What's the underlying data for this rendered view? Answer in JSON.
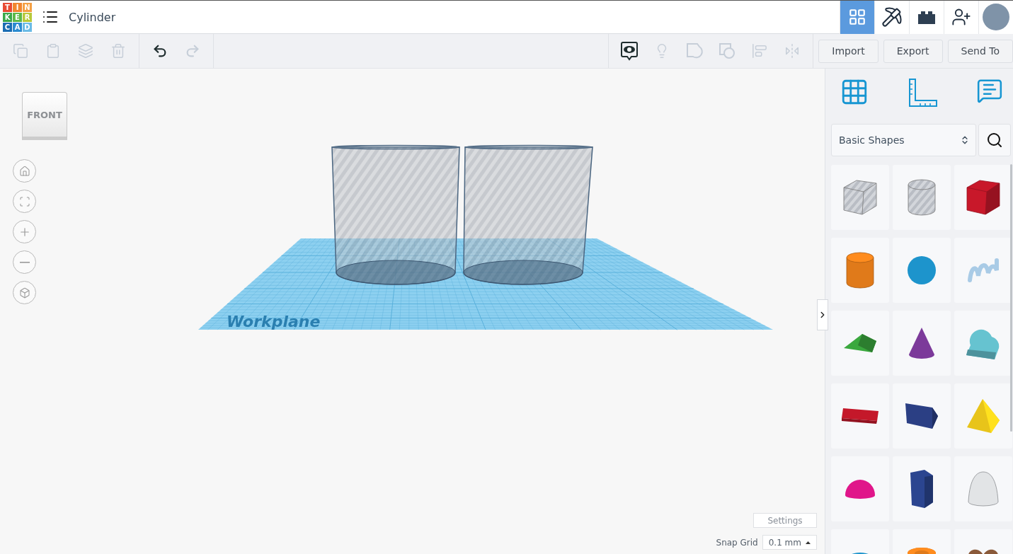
{
  "header": {
    "logo_letters": [
      {
        "text": "T",
        "color": "#e84b34"
      },
      {
        "text": "I",
        "color": "#f2862f"
      },
      {
        "text": "N",
        "color": "#f5a044"
      },
      {
        "text": "K",
        "color": "#3aa84a"
      },
      {
        "text": "E",
        "color": "#5cb947"
      },
      {
        "text": "R",
        "color": "#b7c93a"
      },
      {
        "text": "C",
        "color": "#1b6db3"
      },
      {
        "text": "A",
        "color": "#2b8bd0"
      },
      {
        "text": "D",
        "color": "#6bbbe6"
      }
    ],
    "design_title": "Cylinder",
    "nav_tabs": [
      {
        "kind": "grid",
        "selected": true
      },
      {
        "kind": "pickaxe",
        "selected": false
      },
      {
        "kind": "bricks",
        "selected": false
      },
      {
        "kind": "add-user",
        "selected": false
      },
      {
        "kind": "avatar",
        "selected": false
      }
    ]
  },
  "toolbar": {
    "edit_tools": [
      {
        "kind": "copy",
        "disabled": true
      },
      {
        "kind": "paste",
        "disabled": true
      },
      {
        "kind": "duplicate",
        "disabled": true
      },
      {
        "kind": "delete",
        "disabled": true
      }
    ],
    "history_tools": [
      {
        "kind": "undo",
        "disabled": false
      },
      {
        "kind": "redo",
        "disabled": true
      }
    ],
    "view_tools": [
      {
        "kind": "notes",
        "disabled": false
      },
      {
        "kind": "light",
        "disabled": true
      },
      {
        "kind": "group",
        "disabled": true
      },
      {
        "kind": "hole",
        "disabled": true
      },
      {
        "kind": "align",
        "disabled": true
      },
      {
        "kind": "mirror",
        "disabled": true
      }
    ],
    "actions": [
      "Import",
      "Export",
      "Send To"
    ]
  },
  "canvas": {
    "view_cube_face": "FRONT",
    "nav_controls": [
      {
        "kind": "home"
      },
      {
        "kind": "fit"
      },
      {
        "kind": "zoom-in"
      },
      {
        "kind": "zoom-out"
      },
      {
        "kind": "perspective"
      }
    ],
    "workplane_label": "Workplane",
    "scene_shapes": [
      {
        "kind": "hole-cylinder"
      },
      {
        "kind": "hole-cylinder"
      }
    ],
    "settings": "Settings",
    "snap_grid_label": "Snap Grid",
    "snap_grid_value": "0.1 mm"
  },
  "panel": {
    "tools": [
      {
        "kind": "workplane"
      },
      {
        "kind": "ruler"
      },
      {
        "kind": "notes"
      }
    ],
    "category": "Basic Shapes",
    "shapes": [
      {
        "kind": "box-hole",
        "color": "#c8cbd2"
      },
      {
        "kind": "cylinder-hole",
        "color": "#c8cbd2"
      },
      {
        "kind": "box",
        "color": "#c8182a"
      },
      {
        "kind": "cylinder",
        "color": "#e07a1a"
      },
      {
        "kind": "sphere",
        "color": "#1d94cc"
      },
      {
        "kind": "scribble",
        "color": "#a9cbe6"
      },
      {
        "kind": "roof",
        "color": "#3aa83e"
      },
      {
        "kind": "cone",
        "color": "#7c3a9a"
      },
      {
        "kind": "round-roof",
        "color": "#66c3d0"
      },
      {
        "kind": "text",
        "color": "#c4182a"
      },
      {
        "kind": "polygon",
        "color": "#2b3f84"
      },
      {
        "kind": "pyramid",
        "color": "#e8c41a"
      },
      {
        "kind": "half-sphere",
        "color": "#e0168a"
      },
      {
        "kind": "hexagon",
        "color": "#2b4590"
      },
      {
        "kind": "paraboloid",
        "color": "#e2e4e6"
      },
      {
        "kind": "torus",
        "color": "#1d94cc"
      },
      {
        "kind": "tube",
        "color": "#e07a1a"
      },
      {
        "kind": "heart",
        "color": "#8a5a3a"
      }
    ]
  }
}
